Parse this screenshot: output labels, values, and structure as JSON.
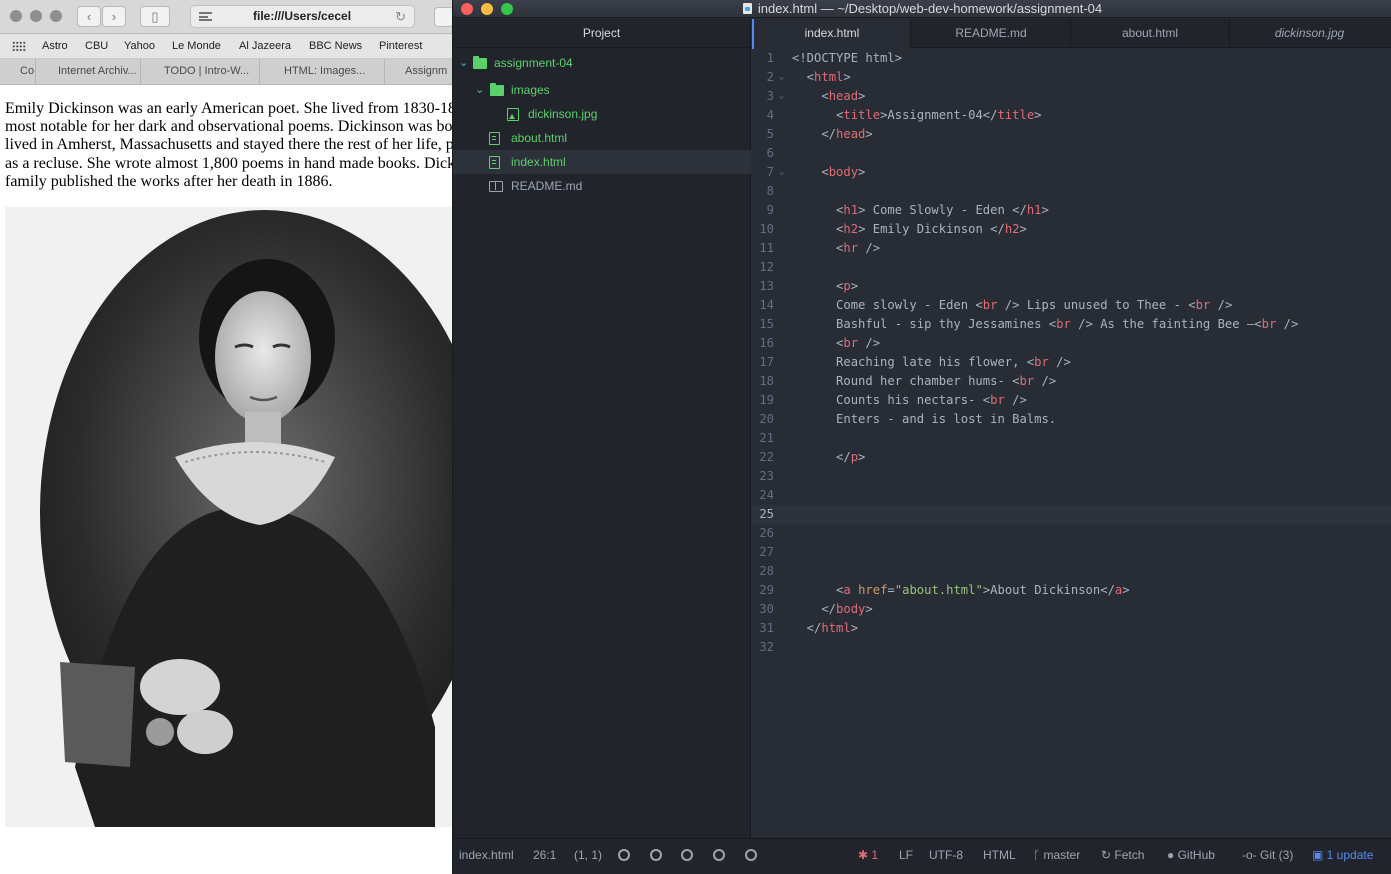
{
  "browser": {
    "address": "file:///Users/cecel",
    "bookmarks": [
      "Astro",
      "CBU",
      "Yahoo",
      "Le Monde",
      "Al Jazeera",
      "BBC News",
      "Pinterest"
    ],
    "tabs": [
      "Co",
      "Internet Archiv...",
      "TODO | Intro-W...",
      "HTML: Images...",
      "Assignm"
    ],
    "paragraph_lines": [
      "Emily Dickinson was an early American poet. She lived from 1830-18",
      "most notable for her dark and observational poems. Dickinson was bo",
      "lived in Amherst, Massachusetts and stayed there the rest of her life, p",
      "as a recluse. She wrote almost 1,800 poems in hand made books. Dick",
      "family published the works after her death in 1886."
    ],
    "image_subject": "portrait-of-emily-dickinson"
  },
  "editor": {
    "window_title": "index.html — ~/Desktop/web-dev-homework/assignment-04",
    "tree": {
      "header": "Project",
      "items": [
        {
          "label": "assignment-04",
          "type": "folder"
        },
        {
          "label": "images",
          "type": "folder"
        },
        {
          "label": "dickinson.jpg",
          "type": "image"
        },
        {
          "label": "about.html",
          "type": "file"
        },
        {
          "label": "index.html",
          "type": "file"
        },
        {
          "label": "README.md",
          "type": "markdown"
        }
      ]
    },
    "tabs": [
      {
        "label": "index.html",
        "active": true
      },
      {
        "label": "README.md"
      },
      {
        "label": "about.html"
      },
      {
        "label": "dickinson.jpg",
        "italic": true
      }
    ],
    "cursor_line": 25,
    "code_lines": [
      [
        [
          "p",
          "<!DOCTYPE html>"
        ]
      ],
      [
        [
          "p",
          "  <"
        ],
        [
          "t",
          "html"
        ],
        [
          "p",
          ">"
        ]
      ],
      [
        [
          "p",
          "    <"
        ],
        [
          "t",
          "head"
        ],
        [
          "p",
          ">"
        ]
      ],
      [
        [
          "p",
          "      <"
        ],
        [
          "t",
          "title"
        ],
        [
          "p",
          ">Assignment-04</"
        ],
        [
          "t",
          "title"
        ],
        [
          "p",
          ">"
        ]
      ],
      [
        [
          "p",
          "    </"
        ],
        [
          "t",
          "head"
        ],
        [
          "p",
          ">"
        ]
      ],
      [],
      [
        [
          "p",
          "    <"
        ],
        [
          "t",
          "body"
        ],
        [
          "p",
          ">"
        ]
      ],
      [],
      [
        [
          "p",
          "      <"
        ],
        [
          "t",
          "h1"
        ],
        [
          "p",
          "> Come Slowly - Eden </"
        ],
        [
          "t",
          "h1"
        ],
        [
          "p",
          ">"
        ]
      ],
      [
        [
          "p",
          "      <"
        ],
        [
          "t",
          "h2"
        ],
        [
          "p",
          "> Emily Dickinson </"
        ],
        [
          "t",
          "h2"
        ],
        [
          "p",
          ">"
        ]
      ],
      [
        [
          "p",
          "      <"
        ],
        [
          "t",
          "hr"
        ],
        [
          "p",
          " />"
        ]
      ],
      [],
      [
        [
          "p",
          "      <"
        ],
        [
          "t",
          "p"
        ],
        [
          "p",
          ">"
        ]
      ],
      [
        [
          "p",
          "      Come slowly - Eden <"
        ],
        [
          "t",
          "br"
        ],
        [
          "p",
          " /> Lips unused to Thee - <"
        ],
        [
          "t",
          "br"
        ],
        [
          "p",
          " />"
        ]
      ],
      [
        [
          "p",
          "      Bashful - sip thy Jessamines <"
        ],
        [
          "t",
          "br"
        ],
        [
          "p",
          " /> As the fainting Bee —<"
        ],
        [
          "t",
          "br"
        ],
        [
          "p",
          " />"
        ]
      ],
      [
        [
          "p",
          "      <"
        ],
        [
          "t",
          "br"
        ],
        [
          "p",
          " />"
        ]
      ],
      [
        [
          "p",
          "      Reaching late his flower, <"
        ],
        [
          "t",
          "br"
        ],
        [
          "p",
          " />"
        ]
      ],
      [
        [
          "p",
          "      Round her chamber hums- <"
        ],
        [
          "t",
          "br"
        ],
        [
          "p",
          " />"
        ]
      ],
      [
        [
          "p",
          "      Counts his nectars- <"
        ],
        [
          "t",
          "br"
        ],
        [
          "p",
          " />"
        ]
      ],
      [
        [
          "p",
          "      Enters - and is lost in Balms."
        ]
      ],
      [],
      [
        [
          "p",
          "      </"
        ],
        [
          "t",
          "p"
        ],
        [
          "p",
          ">"
        ]
      ],
      [],
      [],
      [],
      [],
      [],
      [],
      [
        [
          "p",
          "      <"
        ],
        [
          "t",
          "a"
        ],
        [
          "p",
          " "
        ],
        [
          "a",
          "href"
        ],
        [
          "p",
          "="
        ],
        [
          "s",
          "\"about.html\""
        ],
        [
          "p",
          ">About Dickinson</"
        ],
        [
          "t",
          "a"
        ],
        [
          "p",
          ">"
        ]
      ],
      [
        [
          "p",
          "    </"
        ],
        [
          "t",
          "body"
        ],
        [
          "p",
          ">"
        ]
      ],
      [
        [
          "p",
          "  </"
        ],
        [
          "t",
          "html"
        ],
        [
          "p",
          ">"
        ]
      ],
      []
    ],
    "fold_lines": [
      2,
      3,
      7
    ],
    "status": {
      "file": "index.html",
      "position": "26:1",
      "selection": "(1, 1)",
      "issues": "1",
      "line_ending": "LF",
      "encoding": "UTF-8",
      "grammar": "HTML",
      "branch": "master",
      "fetch": "Fetch",
      "github": "GitHub",
      "git": "Git (3)",
      "update": "1 update"
    }
  },
  "colors": {
    "accent": "#568af2",
    "tree_green": "#5bd16c",
    "tag_red": "#e06c75",
    "string_green": "#98c379",
    "attr_orange": "#d19a66"
  }
}
